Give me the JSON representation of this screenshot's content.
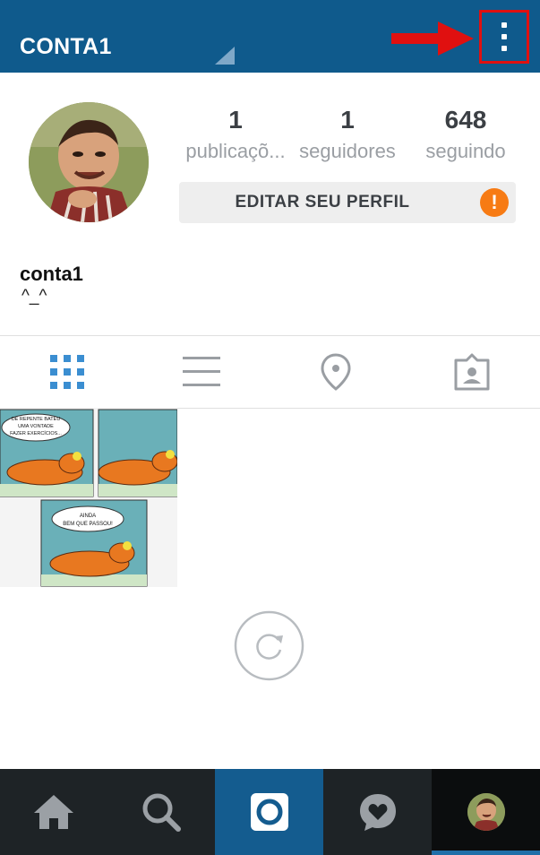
{
  "header": {
    "account_name": "CONTA1",
    "menu_icon": "overflow-menu-icon",
    "annotation_color": "#e01010"
  },
  "profile": {
    "stats": [
      {
        "value": "1",
        "label": "publicaçõ..."
      },
      {
        "value": "1",
        "label": "seguidores"
      },
      {
        "value": "648",
        "label": "seguindo"
      }
    ],
    "edit_button_label": "EDITAR SEU PERFIL",
    "warning_glyph": "!",
    "username": "conta1",
    "bio": "^_^"
  },
  "tabs": [
    {
      "name": "grid-view",
      "icon": "grid-icon",
      "active": true
    },
    {
      "name": "list-view",
      "icon": "list-icon",
      "active": false
    },
    {
      "name": "places",
      "icon": "location-pin-icon",
      "active": false
    },
    {
      "name": "tagged",
      "icon": "tagged-photos-icon",
      "active": false
    }
  ],
  "post": {
    "panel1_text": "DE REPENTE BATEU UMA VONTADE FAZER EXERCÍCIOS...",
    "panel3_text": "AINDA BEM QUE PASSOU!"
  },
  "bottom_nav": [
    {
      "name": "home",
      "icon": "home-icon"
    },
    {
      "name": "search",
      "icon": "search-icon"
    },
    {
      "name": "camera",
      "icon": "camera-icon"
    },
    {
      "name": "activity",
      "icon": "activity-heart-icon"
    },
    {
      "name": "profile",
      "icon": "profile-avatar-icon"
    }
  ],
  "colors": {
    "header_bg": "#0f5a8c",
    "accent_blue": "#3b8ed1",
    "warning_orange": "#f77b14",
    "nav_bg": "#1e2326",
    "nav_active_bg": "#145c8f"
  }
}
